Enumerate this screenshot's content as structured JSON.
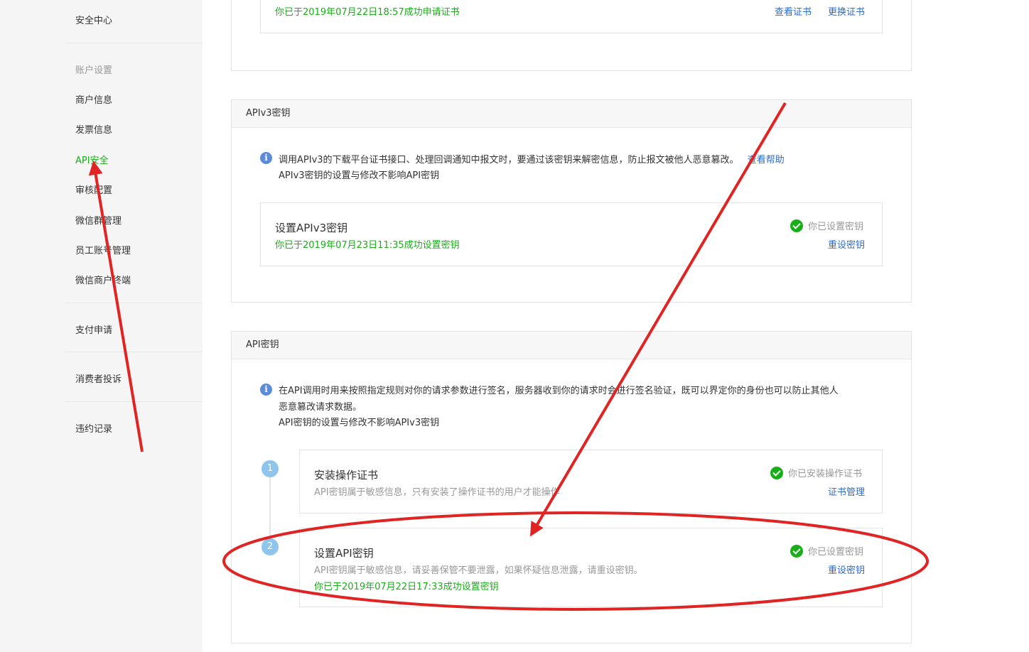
{
  "sidebar": {
    "security_center": "安全中心",
    "group_title": "账户设置",
    "items": [
      {
        "label": "商户信息"
      },
      {
        "label": "发票信息"
      },
      {
        "label": "API安全"
      },
      {
        "label": "审核配置"
      },
      {
        "label": "微信群管理"
      },
      {
        "label": "员工账号管理"
      },
      {
        "label": "微信商户终端"
      }
    ],
    "pay_apply": "支付申请",
    "consumer_complaint": "消费者投诉",
    "violation_record": "违约记录"
  },
  "cert_panel": {
    "status_text": "你已于2019年07月22日18:57成功申请证书",
    "view_link": "查看证书",
    "replace_link": "更换证书"
  },
  "apiv3_panel": {
    "title": "APIv3密钥",
    "info_line1": "调用APIv3的下载平台证书接口、处理回调通知中报文时，要通过该密钥来解密信息，防止报文被他人恶意篡改。",
    "help_link": "查看帮助",
    "info_line2": "APIv3密钥的设置与修改不影响API密钥",
    "card": {
      "title": "设置APIv3密钥",
      "sub": "你已于2019年07月23日11:35成功设置密钥",
      "status": "你已设置密钥",
      "action": "重设密钥"
    }
  },
  "api_panel": {
    "title": "API密钥",
    "info_line1": "在API调用时用来按照指定规则对你的请求参数进行签名，服务器收到你的请求时会进行签名验证，既可以界定你的身份也可以防止其他人",
    "info_line2": "恶意篡改请求数据。",
    "info_line3": "API密钥的设置与修改不影响APIv3密钥",
    "steps": [
      {
        "number": "1",
        "title": "安装操作证书",
        "desc": "API密钥属于敏感信息，只有安装了操作证书的用户才能操作",
        "status": "你已安装操作证书",
        "action": "证书管理"
      },
      {
        "number": "2",
        "title": "设置API密钥",
        "desc": "API密钥属于敏感信息，请妥善保管不要泄露，如果怀疑信息泄露，请重设密钥。",
        "sub": "你已于2019年07月22日17:33成功设置密钥",
        "status": "你已设置密钥",
        "action": "重设密钥"
      }
    ]
  },
  "colors": {
    "accent_green": "#1aad19",
    "link_blue": "#2d6bc5",
    "annotation_red": "#e02424"
  }
}
